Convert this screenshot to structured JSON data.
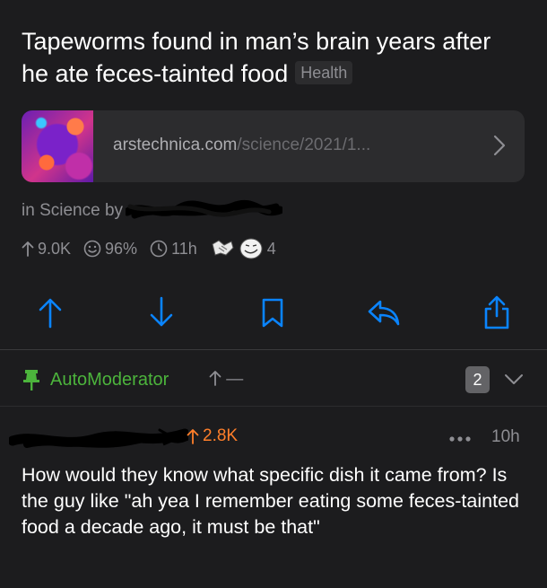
{
  "post": {
    "title": "Tapeworms found in man’s brain years after he ate feces-tainted food",
    "flair": "Health",
    "link": {
      "domain": "arstechnica.com",
      "path": "/science/2021/1..."
    },
    "meta_prefix": "in Science by",
    "author": "",
    "stats": {
      "upvotes": "9.0K",
      "upvote_ratio": "96%",
      "age": "11h",
      "award_count": "4"
    }
  },
  "actions": [
    {
      "name": "upvote",
      "icon": "arrow-up-icon"
    },
    {
      "name": "downvote",
      "icon": "arrow-down-icon"
    },
    {
      "name": "save",
      "icon": "bookmark-icon"
    },
    {
      "name": "reply",
      "icon": "reply-icon"
    },
    {
      "name": "share",
      "icon": "share-icon"
    }
  ],
  "comments": [
    {
      "author": "AutoModerator",
      "score": "—",
      "collapsed_count": "2",
      "pinned": true
    },
    {
      "author": "",
      "score": "2.8K",
      "age": "10h",
      "body": "How would they know what specific dish it came from? Is the guy like \"ah yea I remember eating some feces-tainted food a decade ago, it must be that\""
    }
  ],
  "colors": {
    "background": "#1c1c1e",
    "accent": "#0a84ff",
    "mod_green": "#4cb43c",
    "upvote_orange": "#ff7f2a",
    "secondary_text": "#8e8e93"
  }
}
